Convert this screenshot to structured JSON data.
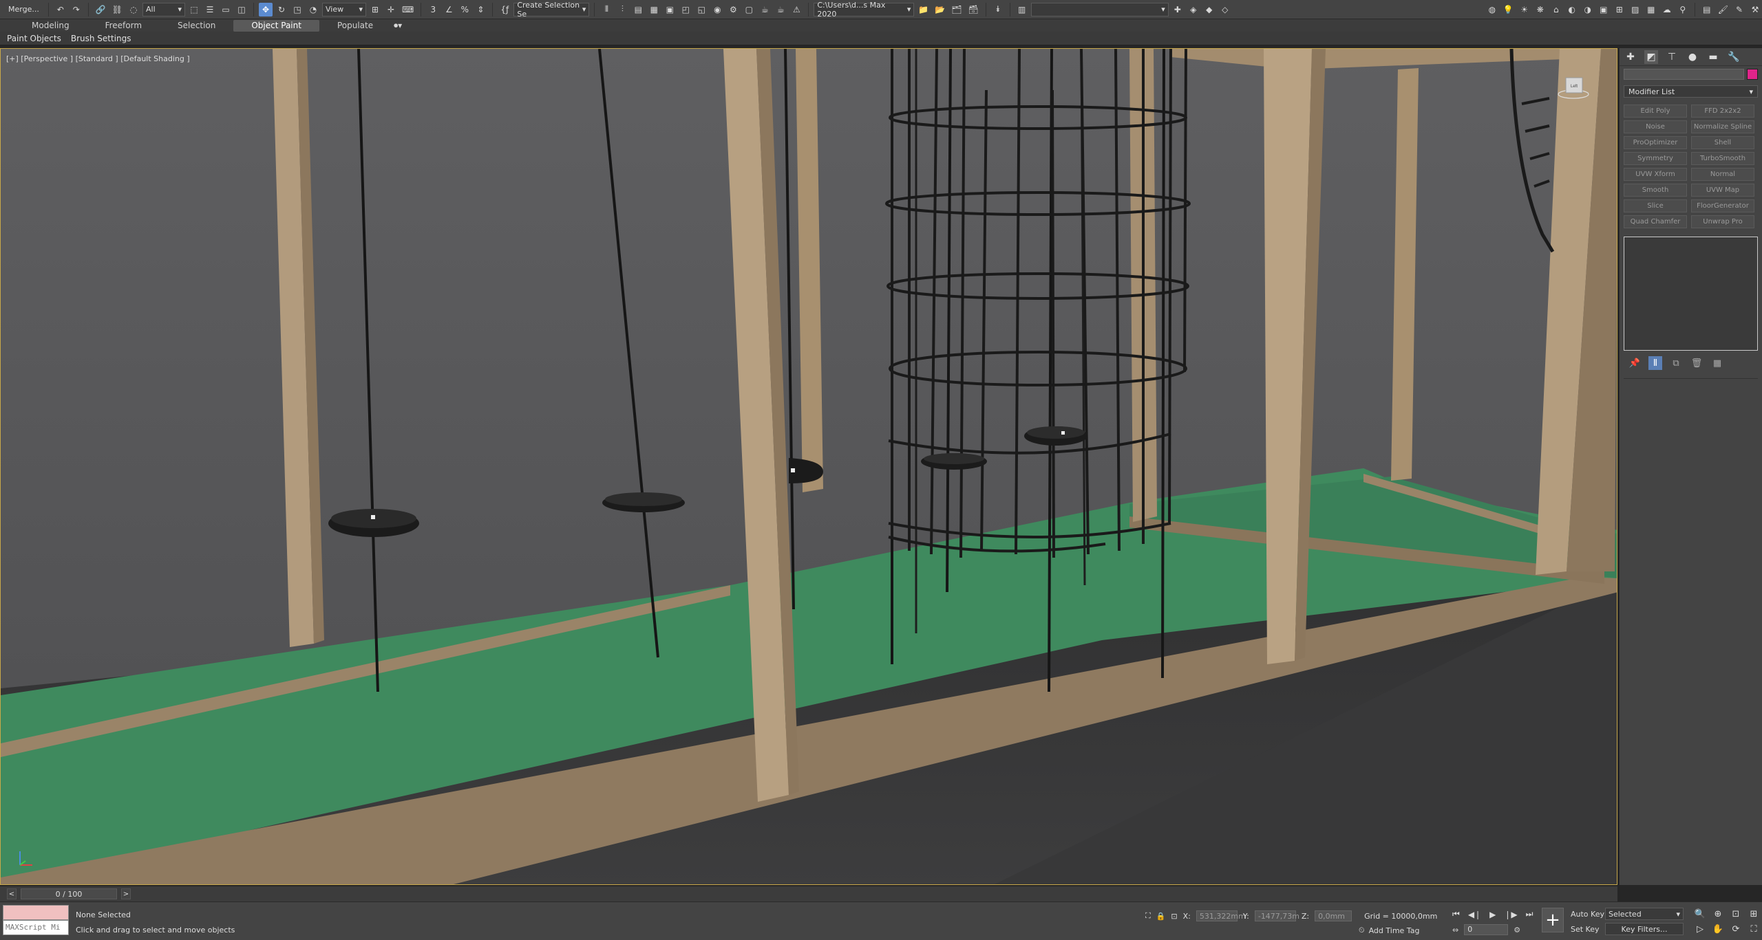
{
  "toolbar": {
    "merge_label": "Merge...",
    "selection_filter": "All",
    "view_select": "View",
    "selection_set": "Create Selection Se",
    "project_path": "C:\\Users\\d...s Max 2020",
    "undo_icon": "undo-icon",
    "redo_icon": "redo-icon",
    "link_icon": "link-icon"
  },
  "ribbon": {
    "tabs": [
      "Modeling",
      "Freeform",
      "Selection",
      "Object Paint",
      "Populate"
    ],
    "active_tab": "Object Paint",
    "tools": [
      "Paint Objects",
      "Brush Settings"
    ]
  },
  "viewport": {
    "label": "[+] [Perspective ] [Standard ] [Default Shading ]",
    "viewcube_label": "Left"
  },
  "command_panel": {
    "object_name": "",
    "object_color": "#e0248a",
    "modifier_list": "Modifier List",
    "modifiers": [
      "Edit Poly",
      "FFD 2x2x2",
      "Noise",
      "Normalize Spline",
      "ProOptimizer",
      "Shell",
      "Symmetry",
      "TurboSmooth",
      "UVW Xform",
      "Normal",
      "Smooth",
      "UVW Map",
      "Slice",
      "FloorGenerator",
      "Quad Chamfer",
      "Unwrap Pro"
    ]
  },
  "timeslider": {
    "frame_display": "0 / 100"
  },
  "status": {
    "maxscript_label": "MAXScript Mi",
    "selection": "None Selected",
    "prompt": "Click and drag to select and move objects",
    "x_label": "X:",
    "x_value": "531,322mm",
    "y_label": "Y:",
    "y_value": "-1477,73m",
    "z_label": "Z:",
    "z_value": "0,0mm",
    "grid": "Grid = 10000,0mm",
    "add_time_tag": "Add Time Tag",
    "current_frame": "0",
    "auto_key": "Auto Key",
    "set_key": "Set Key",
    "key_mode": "Selected",
    "key_filters": "Key Filters..."
  },
  "colors": {
    "accent": "#5b8bd0",
    "viewport_border": "#c8a84a",
    "floor_green": "#3f8a5e",
    "frame_wood": "#b19a7c"
  }
}
